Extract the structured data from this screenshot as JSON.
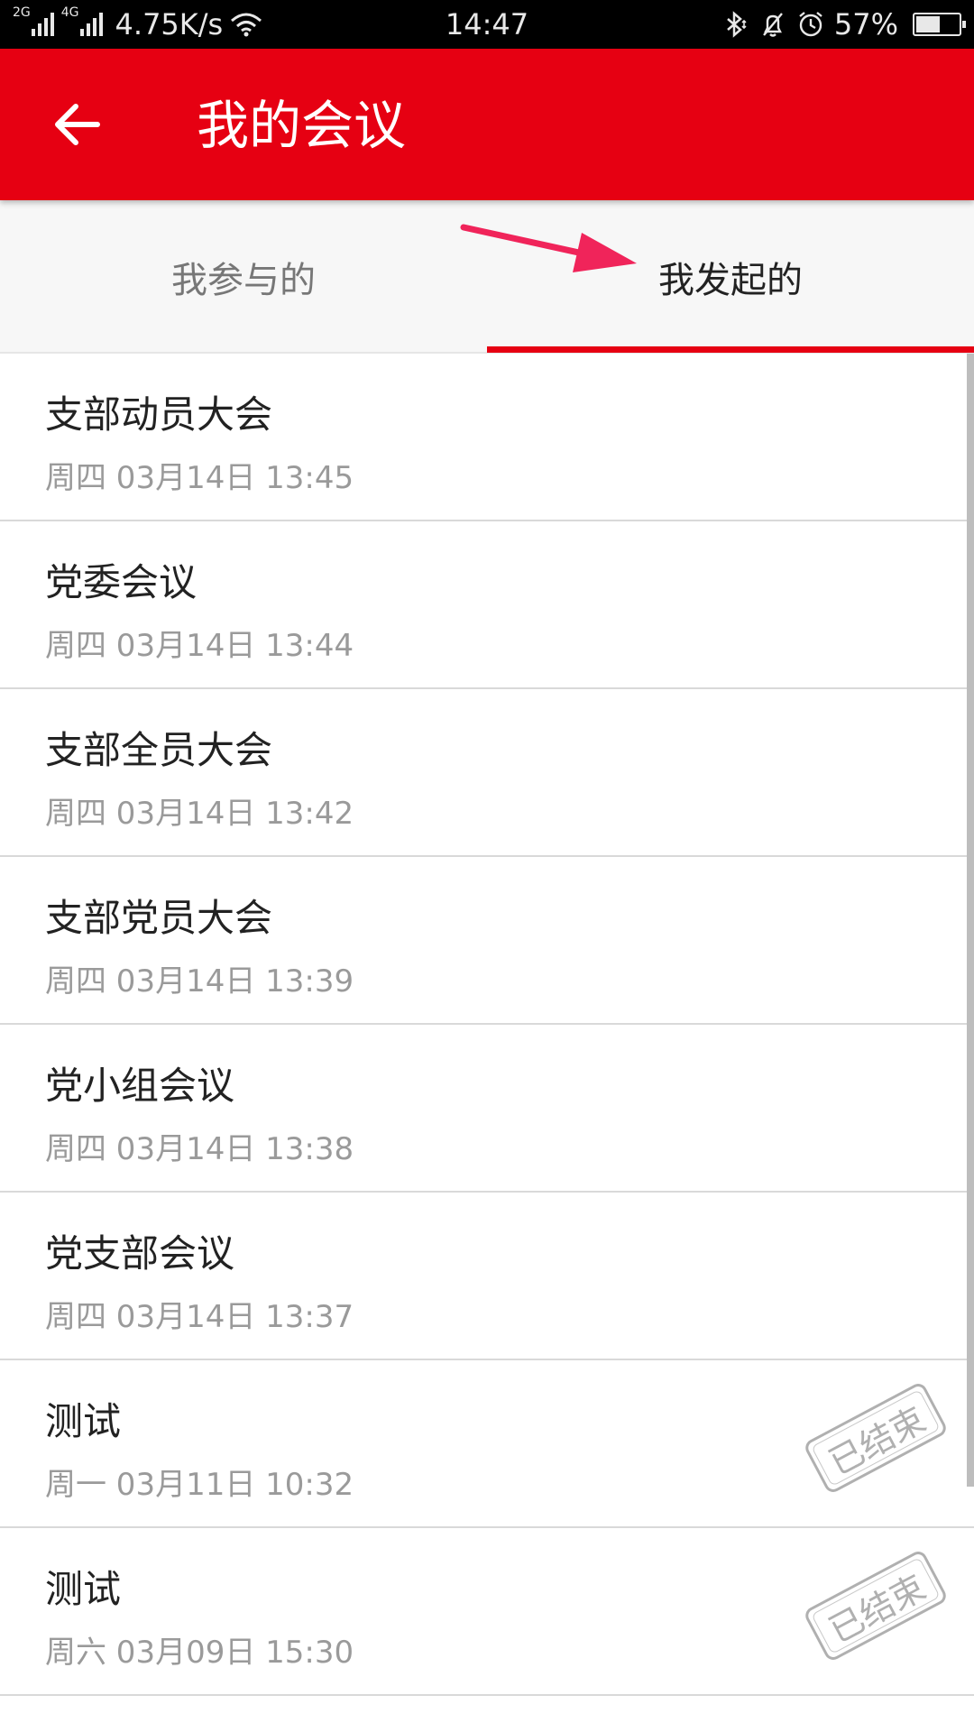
{
  "status_bar": {
    "network_2g": "2G",
    "network_4g": "4G",
    "speed": "4.75K/s",
    "time": "14:47",
    "battery": "57%",
    "battery_level": 0.57
  },
  "app_bar": {
    "title": "我的会议",
    "color": "#e60012"
  },
  "tabs": [
    {
      "label": "我参与的",
      "selected": false
    },
    {
      "label": "我发起的",
      "selected": true
    }
  ],
  "meetings": [
    {
      "title": "支部动员大会",
      "time": "周四 03月14日 13:45",
      "ended_label": ""
    },
    {
      "title": "党委会议",
      "time": "周四 03月14日 13:44",
      "ended_label": ""
    },
    {
      "title": "支部全员大会",
      "time": "周四 03月14日 13:42",
      "ended_label": ""
    },
    {
      "title": "支部党员大会",
      "time": "周四 03月14日 13:39",
      "ended_label": ""
    },
    {
      "title": "党小组会议",
      "time": "周四 03月14日 13:38",
      "ended_label": ""
    },
    {
      "title": "党支部会议",
      "time": "周四 03月14日 13:37",
      "ended_label": ""
    },
    {
      "title": "测试",
      "time": "周一 03月11日 10:32",
      "ended_label": "已结束"
    },
    {
      "title": "测试",
      "time": "周六 03月09日 15:30",
      "ended_label": "已结束"
    }
  ]
}
